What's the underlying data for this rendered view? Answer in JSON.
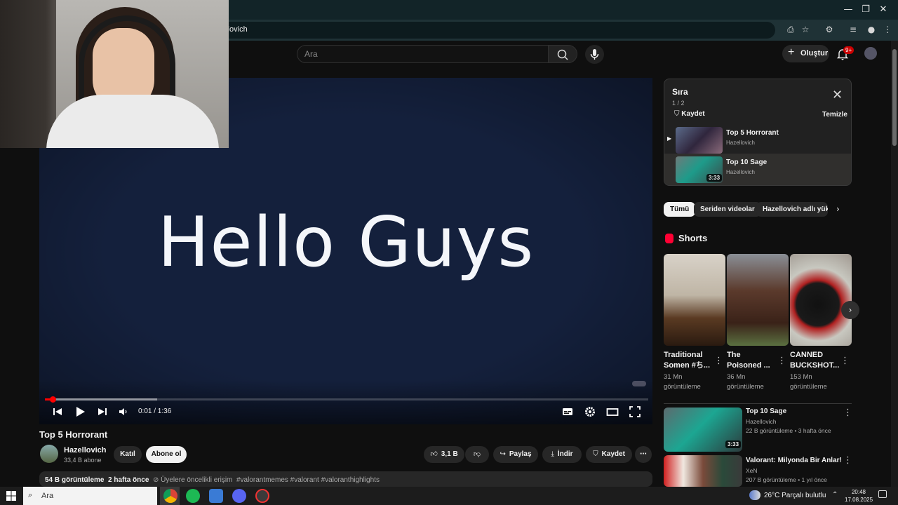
{
  "browser": {
    "url": "ellovich",
    "window_controls": [
      "—",
      "❐",
      "✕"
    ]
  },
  "header": {
    "search_placeholder": "Ara",
    "create_label": "Oluştur",
    "notifications_badge": "9+"
  },
  "player": {
    "overlay_text": "Hello Guys",
    "time": "0:01 / 1:36",
    "progress": 0.01
  },
  "video": {
    "title": "Top 5 Horrorant",
    "channel": "Hazellovich",
    "subscribers": "33,4 B abone",
    "join_label": "Katıl",
    "subscribe_label": "Abone ol",
    "likes": "3,1 B",
    "share_label": "Paylaş",
    "download_label": "İndir",
    "save_label": "Kaydet",
    "views": "54 B görüntüleme",
    "age": "2 hafta önce",
    "members": "Üyelere öncelikli erişim",
    "tags": "#valorantmemes #valorant #valoranthighlights"
  },
  "playlist": {
    "title": "Sıra",
    "count": "1 / 2",
    "save_label": "Kaydet",
    "clear_label": "Temizle",
    "items": [
      {
        "title": "Top 5 Horrorant",
        "channel": "Hazellovich",
        "duration": ""
      },
      {
        "title": "Top 10 Sage",
        "channel": "Hazellovich",
        "duration": "3:33"
      }
    ]
  },
  "chips": [
    "Tümü",
    "Seriden videolar",
    "Hazellovich adlı yükle"
  ],
  "shorts": {
    "heading": "Shorts",
    "items": [
      {
        "title1": "Traditional",
        "title2": "Somen #ち...",
        "views1": "31 Mn",
        "views2": "görüntüleme"
      },
      {
        "title1": "The",
        "title2": "Poisoned ...",
        "views1": "36 Mn",
        "views2": "görüntüleme"
      },
      {
        "title1": "CANNED",
        "title2": "BUCKSHOT...",
        "views1": "153 Mn",
        "views2": "görüntüleme"
      }
    ]
  },
  "related": [
    {
      "title": "Top 10 Sage",
      "channel": "Hazellovich",
      "meta": "22 B görüntüleme • 3 hafta önce",
      "duration": "3:33"
    },
    {
      "title": "Valorant: Milyonda Bir Anlar!",
      "channel": "XeN",
      "meta": "207 B görüntüleme • 1 yıl önce",
      "duration": ""
    }
  ],
  "taskbar": {
    "search_label": "Ara",
    "weather": "26°C  Parçalı bulutlu",
    "time": "20:48",
    "date": "17.08.2025"
  },
  "colors": {
    "accent": "#ff0000",
    "page_bg": "#0f0f0f",
    "player_bg": "#14203c"
  }
}
